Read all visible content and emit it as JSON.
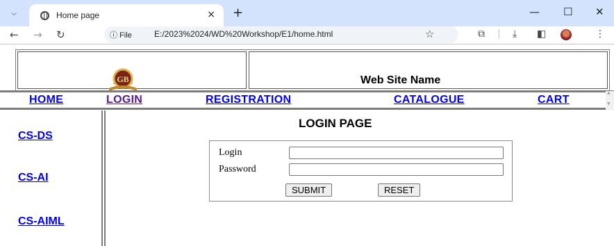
{
  "browser": {
    "tab_title": "Home page",
    "tab_close": "×",
    "new_tab": "+",
    "window_controls": {
      "minimize": "—",
      "maximize": "☐",
      "close": "✕"
    },
    "site_info_label": "ⓘ File",
    "url": "E:/2023%2024/WD%20Workshop/E1/home.html"
  },
  "header": {
    "logo_icon": "college-crest-logo",
    "site_name": "Web Site Name"
  },
  "nav": {
    "items": [
      {
        "label": "HOME"
      },
      {
        "label": "LOGIN"
      },
      {
        "label": "REGISTRATION"
      },
      {
        "label": "CATALOGUE"
      },
      {
        "label": "CART"
      }
    ]
  },
  "sidebar": {
    "items": [
      {
        "label": "CS-DS"
      },
      {
        "label": "CS-AI"
      },
      {
        "label": "CS-AIML"
      }
    ]
  },
  "login": {
    "title": "LOGIN PAGE",
    "login_label": "Login",
    "login_value": "",
    "password_label": "Password",
    "password_value": "",
    "submit_label": "SUBMIT",
    "reset_label": "RESET"
  },
  "colors": {
    "link": "#0000ee",
    "visited_link": "#551a8b",
    "tabbar": "#d3e3fd"
  }
}
